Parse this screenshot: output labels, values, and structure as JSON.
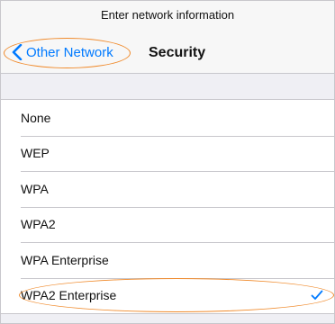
{
  "header": {
    "title": "Enter network information",
    "back_label": "Other Network",
    "nav_title": "Security"
  },
  "security_options": [
    {
      "label": "None",
      "selected": false
    },
    {
      "label": "WEP",
      "selected": false
    },
    {
      "label": "WPA",
      "selected": false
    },
    {
      "label": "WPA2",
      "selected": false
    },
    {
      "label": "WPA Enterprise",
      "selected": false
    },
    {
      "label": "WPA2 Enterprise",
      "selected": true
    }
  ],
  "colors": {
    "accent": "#007aff",
    "highlight": "#f08a2b",
    "background": "#efeff4"
  },
  "icons": {
    "back": "chevron-left-icon",
    "selected": "checkmark-icon"
  }
}
